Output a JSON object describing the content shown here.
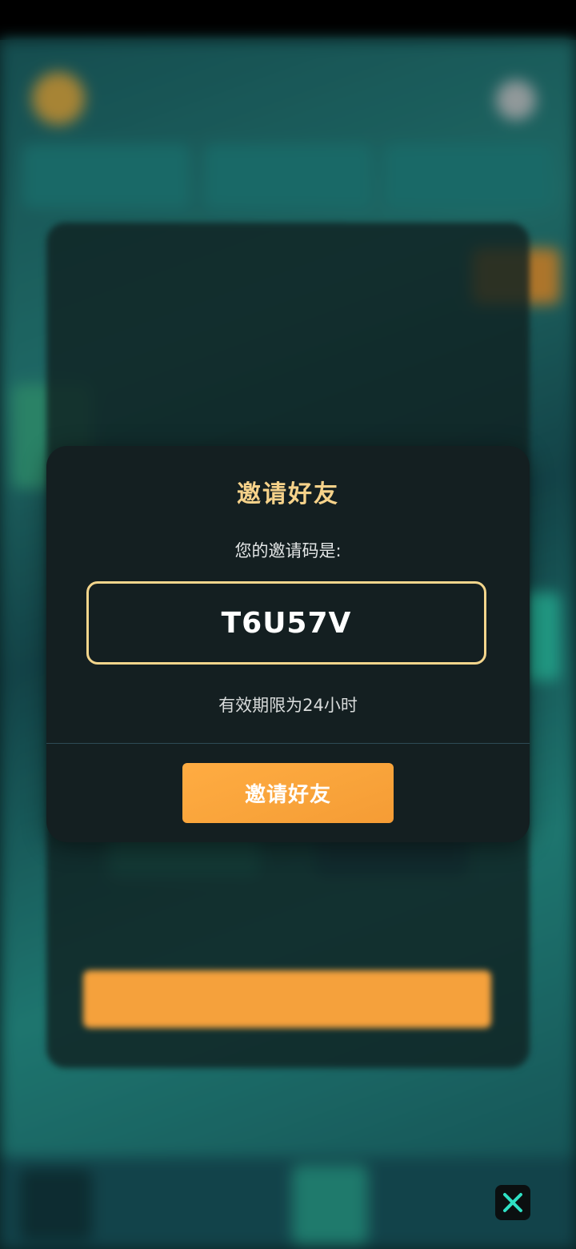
{
  "dialog": {
    "title": "邀请好友",
    "code_label": "您的邀请码是:",
    "invite_code": "T6U57V",
    "validity_text": "有效期限为24小时",
    "invite_button_label": "邀请好友"
  },
  "colors": {
    "title": "#f6d28a",
    "code_border": "#f3d58c",
    "button": "#f9a43b",
    "modal_bg": "#141f21",
    "close_icon": "#2fe0c4"
  },
  "icons": {
    "close": "close-icon"
  }
}
